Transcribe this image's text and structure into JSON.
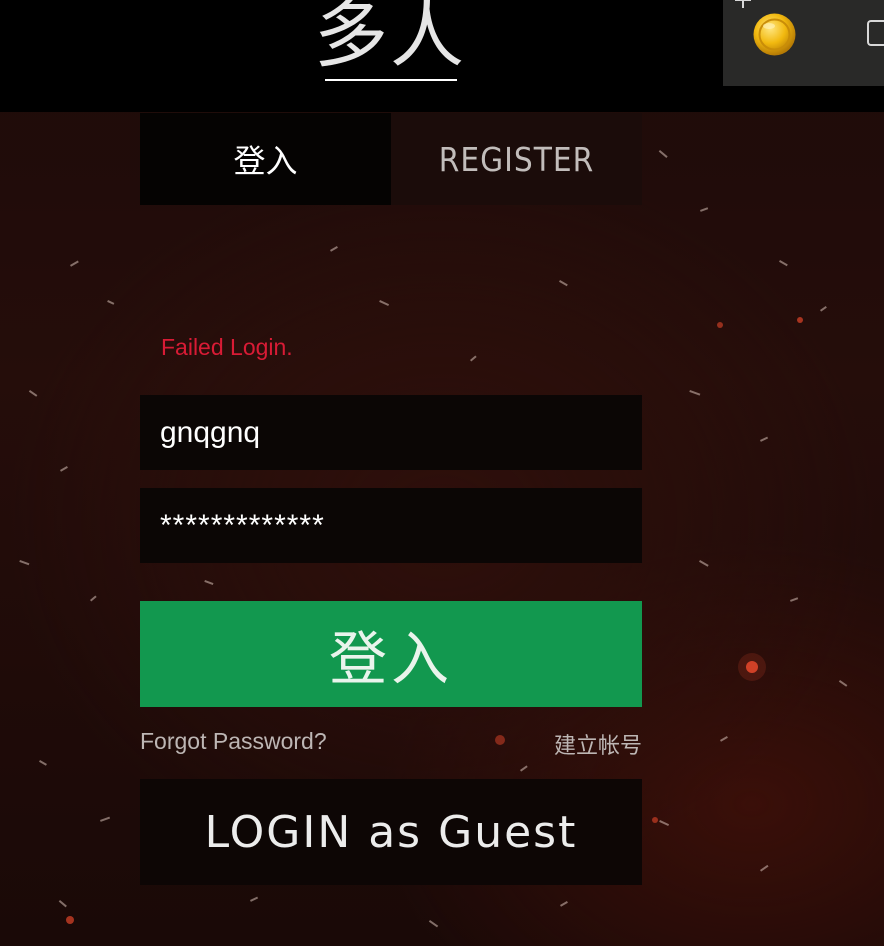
{
  "header": {
    "title": "多人"
  },
  "currency_panel": {
    "icons": [
      "plus-icon",
      "coin-icon",
      "panel-box-icon"
    ]
  },
  "tabs": [
    {
      "label": "登入",
      "active": true
    },
    {
      "label": "REGISTER",
      "active": false
    }
  ],
  "login_form": {
    "error_message": "Failed Login.",
    "username_value": "gnqgnq",
    "password_mask": "*************",
    "submit_label": "登入",
    "forgot_password_label": "Forgot Password?",
    "create_account_label": "建立帐号",
    "guest_login_label": "LOGIN as Guest"
  },
  "colors": {
    "error": "#d81b35",
    "submit_button": "#12984f",
    "background": "#1d0b09",
    "topbar": "#000000"
  }
}
